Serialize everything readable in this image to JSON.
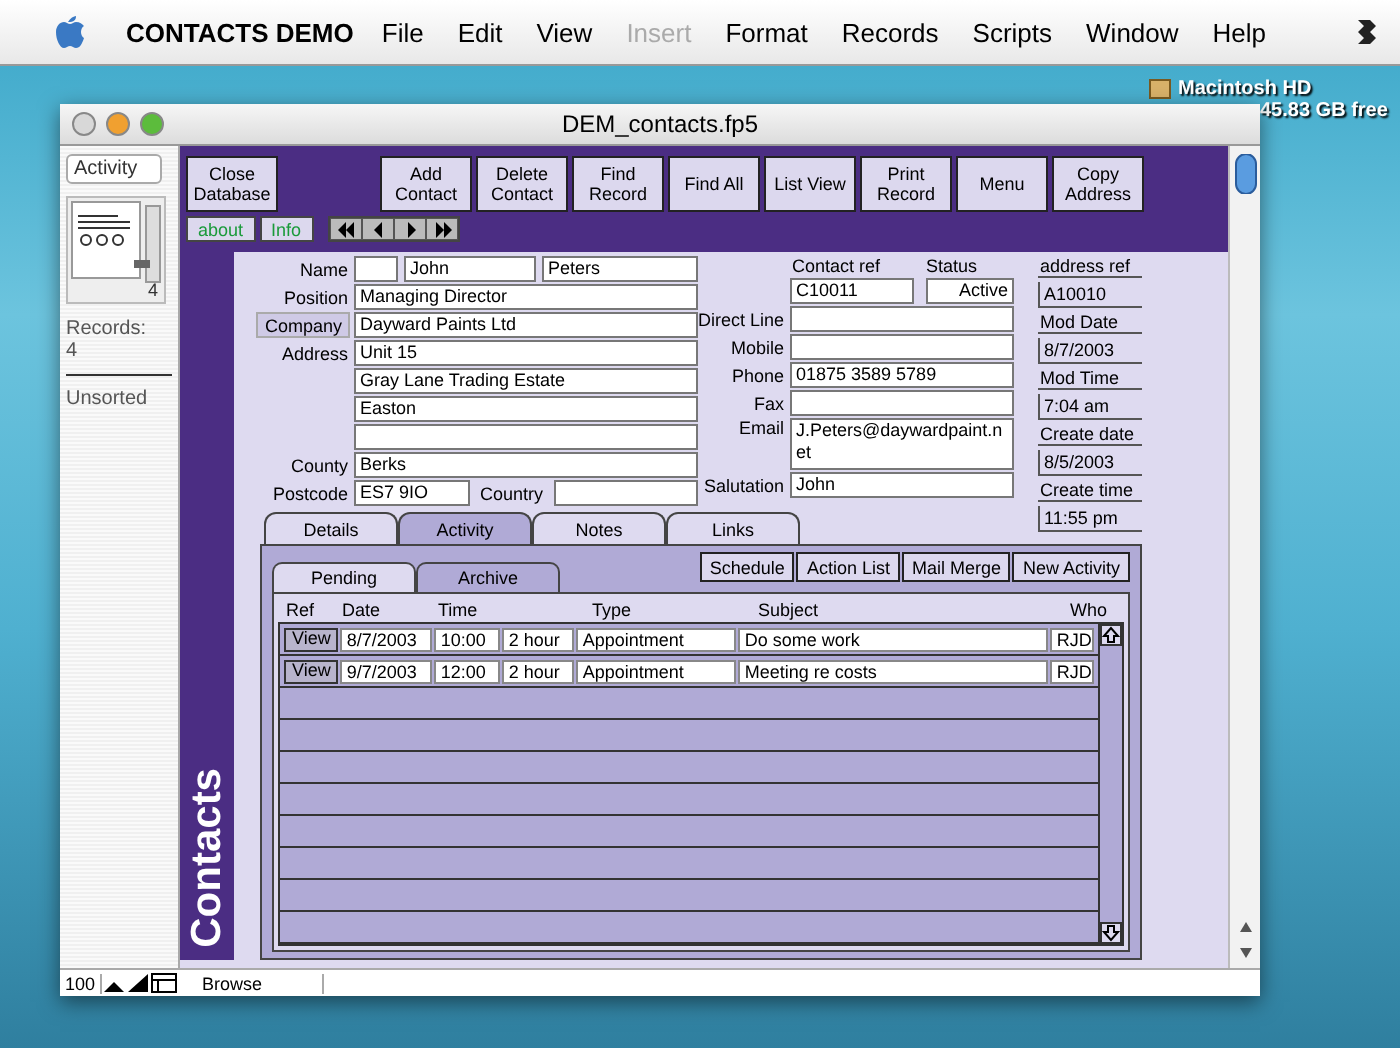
{
  "menubar": {
    "app_name": "CONTACTS DEMO",
    "items": [
      {
        "label": "File",
        "disabled": false
      },
      {
        "label": "Edit",
        "disabled": false
      },
      {
        "label": "View",
        "disabled": false
      },
      {
        "label": "Insert",
        "disabled": true
      },
      {
        "label": "Format",
        "disabled": false
      },
      {
        "label": "Records",
        "disabled": false
      },
      {
        "label": "Scripts",
        "disabled": false
      },
      {
        "label": "Window",
        "disabled": false
      },
      {
        "label": "Help",
        "disabled": false
      }
    ]
  },
  "desktop": {
    "disk_name": "Macintosh HD",
    "disk_free": "45.83 GB free"
  },
  "window": {
    "title": "DEM_contacts.fp5"
  },
  "status_area": {
    "layout": "Activity",
    "record_count": "4",
    "records_label": "Records:",
    "records_value": "4",
    "sort_state": "Unsorted"
  },
  "toolbar": {
    "buttons": [
      "Close Database",
      "Add Contact",
      "Delete Contact",
      "Find Record",
      "Find All",
      "List View",
      "Print Record",
      "Menu",
      "Copy Address"
    ],
    "small_buttons": [
      "about",
      "Info"
    ]
  },
  "form_left": [
    {
      "kind": "name",
      "label": "Name",
      "first": "John",
      "last": "Peters"
    },
    {
      "kind": "field",
      "label": "Position",
      "value": "Managing Director"
    },
    {
      "kind": "button",
      "label": "Company",
      "value": "Dayward Paints Ltd"
    },
    {
      "kind": "field",
      "label": "Address",
      "value": "Unit 15"
    },
    {
      "kind": "field",
      "value": "Gray Lane Trading Estate"
    },
    {
      "kind": "field",
      "value": "Easton"
    },
    {
      "kind": "field"
    },
    {
      "kind": "field",
      "label": "County",
      "value": "Berks"
    },
    {
      "kind": "postcode",
      "label": "Postcode",
      "value": "ES7 9IO",
      "country_label": "Country"
    }
  ],
  "form_middle": {
    "contact_ref_label": "Contact ref",
    "contact_ref": "C10011",
    "status_label": "Status",
    "status": "Active",
    "rows": [
      {
        "label": "Direct Line"
      },
      {
        "label": "Mobile"
      },
      {
        "label": "Phone",
        "value": "01875 3589 5789"
      },
      {
        "label": "Fax"
      },
      {
        "label": "Email",
        "value": "J.Peters@daywardpaint.net",
        "tall": true
      },
      {
        "label": "Salutation",
        "value": "John"
      }
    ]
  },
  "form_right": [
    {
      "label": "address ref",
      "value": "A10010"
    },
    {
      "label": "Mod Date",
      "value": "8/7/2003"
    },
    {
      "label": "Mod Time",
      "value": "7:04 am"
    },
    {
      "label": "Create date",
      "value": "8/5/2003"
    },
    {
      "label": "Create time",
      "value": "11:55 pm"
    }
  ],
  "tabs": [
    {
      "label": "Details",
      "selected": false
    },
    {
      "label": "Activity",
      "selected": true
    },
    {
      "label": "Notes",
      "selected": false
    },
    {
      "label": "Links",
      "selected": false
    }
  ],
  "subtabs": [
    {
      "label": "Pending",
      "selected": true
    },
    {
      "label": "Archive",
      "selected": false
    }
  ],
  "activity_buttons": [
    "Schedule",
    "Action List",
    "Mail Merge",
    "New Activity"
  ],
  "table": {
    "columns": [
      "Ref",
      "Date",
      "Time",
      "Type",
      "Subject",
      "Who"
    ],
    "rows": [
      {
        "button": "View",
        "date": "8/7/2003",
        "time": "10:00",
        "duration": "2 hour",
        "type": "Appointment",
        "subject": "Do some work",
        "who": "RJD"
      },
      {
        "button": "View",
        "date": "9/7/2003",
        "time": "12:00",
        "duration": "2 hour",
        "type": "Appointment",
        "subject": "Meeting re costs",
        "who": "RJD"
      }
    ]
  },
  "side_label": "Contacts",
  "status_bar": {
    "zoom": "100",
    "mode": "Browse"
  }
}
